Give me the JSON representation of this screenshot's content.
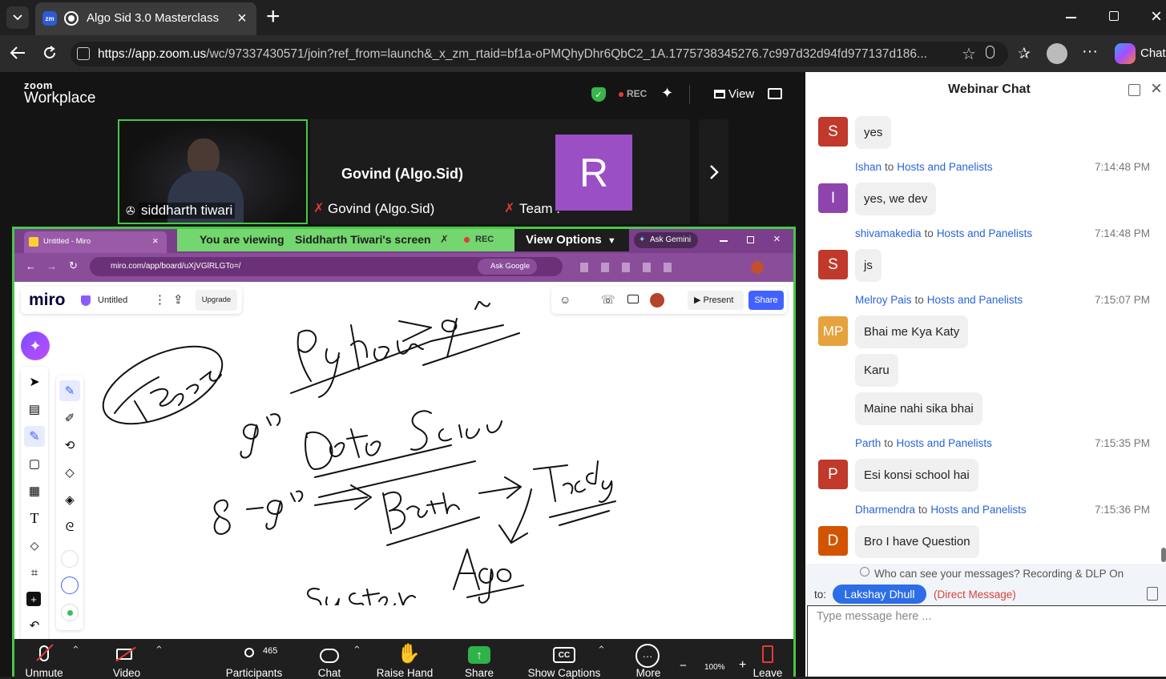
{
  "browser": {
    "tab_title": "Algo Sid 3.0 Masterclass",
    "tab_icon": "zm",
    "new_tab": "+",
    "url_host": "https://app.zoom.us",
    "url_rest": "/wc/97337430571/join?ref_from=launch&_x_zm_rtaid=bf1a-oPMQhyDhr6QbC2_1A.1775738345276.7c997d32d94fd977137d186...",
    "copilot_label": "Chat"
  },
  "zoom": {
    "brand_top": "zoom",
    "brand_bottom": "Workplace",
    "rec_label": "REC",
    "view_label": "View",
    "video_tiles": [
      {
        "name": "siddharth tiwari"
      },
      {
        "title": "Govind (Algo.Sid)",
        "name": "Govind (Algo.Sid)"
      },
      {
        "avatar": "R",
        "name": "Team ."
      }
    ],
    "share_banner": {
      "prefix": "You are viewing",
      "presenter": "Siddharth Tiwari's screen",
      "rec": "REC",
      "view_options": "View Options"
    }
  },
  "shared_screen": {
    "tab1": "Untitled - Miro",
    "ask_gemini": "Ask Gemini",
    "url": "miro.com/app/board/uXjVGlRLGTo=/",
    "ask_google": "Ask Google",
    "miro_logo": "miro",
    "board_name": "Untitled",
    "upgrade": "Upgrade",
    "present": "Present",
    "share": "Share"
  },
  "toolbar": {
    "unmute": "Unmute",
    "video": "Video",
    "participants": "Participants",
    "participants_count": "465",
    "chat": "Chat",
    "raise_hand": "Raise Hand",
    "share": "Share",
    "captions": "Show Captions",
    "more": "More",
    "leave": "Leave",
    "zoom_level": "100%"
  },
  "chat": {
    "title": "Webinar Chat",
    "messages": [
      {
        "avatar": "S",
        "color": "#c0392b",
        "text": "yes"
      },
      {
        "sender": "Ishan",
        "to": "to",
        "recipient": "Hosts and Panelists",
        "time": "7:14:48 PM",
        "avatar": "I",
        "color": "#8e44ad",
        "text": "yes, we dev"
      },
      {
        "sender": "shivamakedia",
        "to": "to",
        "recipient": "Hosts and Panelists",
        "time": "7:14:48 PM",
        "avatar": "S",
        "color": "#c0392b",
        "text": "js"
      },
      {
        "sender": "Melroy Pais",
        "to": "to",
        "recipient": "Hosts and Panelists",
        "time": "7:15:07 PM",
        "avatar": "MP",
        "color": "#e6a23c",
        "texts": [
          "Bhai me Kya Katy",
          "Karu",
          "Maine nahi sika bhai"
        ]
      },
      {
        "sender": "Parth",
        "to": "to",
        "recipient": "Hosts and Panelists",
        "time": "7:15:35 PM",
        "avatar": "P",
        "color": "#c0392b",
        "text": "Esi konsi school hai"
      },
      {
        "sender": "Dharmendra",
        "to": "to",
        "recipient": "Hosts and Panelists",
        "time": "7:15:36 PM",
        "avatar": "D",
        "color": "#d35400",
        "text": "Bro I have Question"
      }
    ],
    "privacy_note": "Who can see your messages? Recording & DLP On",
    "to_label": "to:",
    "recipient": "Lakshay Dhull",
    "dm_note": "(Direct Message)",
    "input_placeholder": "Type message here ..."
  }
}
